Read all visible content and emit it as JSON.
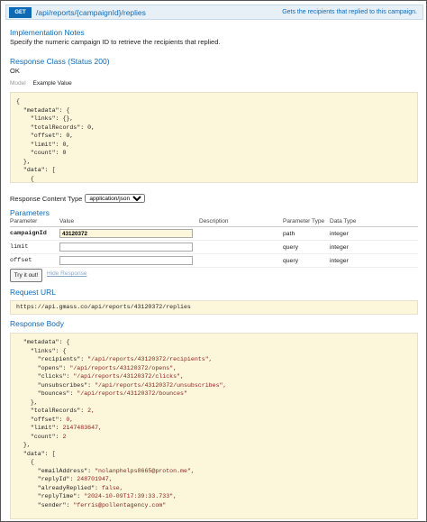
{
  "operation": {
    "method": "GET",
    "path": "/api/reports/{campaignId}/replies",
    "summary": "Gets the recipients that replied to this campaign."
  },
  "implementation_notes": {
    "heading": "Implementation Notes",
    "text": "Specify the numeric campaign ID to retrieve the recipients that replied."
  },
  "response_class": {
    "heading": "Response Class (Status 200)",
    "text": "OK"
  },
  "tabs": {
    "model": "Model",
    "example": "Example Value"
  },
  "example_lines": [
    "{",
    "  \"metadata\": {",
    "    \"links\": {},",
    "    \"totalRecords\": 0,",
    "    \"offset\": 0,",
    "    \"limit\": 0,",
    "    \"count\": 0",
    "  },",
    "  \"data\": [",
    "    {"
  ],
  "response_content_type": {
    "label": "Response Content Type",
    "value": "application/json"
  },
  "parameters": {
    "heading": "Parameters",
    "columns": [
      "Parameter",
      "Value",
      "Description",
      "Parameter Type",
      "Data Type"
    ],
    "rows": [
      {
        "name": "campaignId",
        "value": "43120372",
        "description": "",
        "ptype": "path",
        "dtype": "integer"
      },
      {
        "name": "limit",
        "value": "",
        "description": "",
        "ptype": "query",
        "dtype": "integer"
      },
      {
        "name": "offset",
        "value": "",
        "description": "",
        "ptype": "query",
        "dtype": "integer"
      }
    ]
  },
  "buttons": {
    "try": "Try it out!",
    "hide": "Hide Response"
  },
  "request_url": {
    "heading": "Request URL",
    "value": "https://api.gmass.co/api/reports/43120372/replies"
  },
  "response_body": {
    "heading": "Response Body",
    "lines": [
      [
        "  \"metadata\": {",
        ""
      ],
      [
        "    \"links\": {",
        ""
      ],
      [
        "      \"recipients\": ",
        "\"/api/reports/43120372/recipients\","
      ],
      [
        "      \"opens\": ",
        "\"/api/reports/43120372/opens\","
      ],
      [
        "      \"clicks\": ",
        "\"/api/reports/43120372/clicks\","
      ],
      [
        "      \"unsubscribes\": ",
        "\"/api/reports/43120372/unsubscribes\","
      ],
      [
        "      \"bounces\": ",
        "\"/api/reports/43120372/bounces\""
      ],
      [
        "    },",
        ""
      ],
      [
        "    \"totalRecords\": ",
        "2,"
      ],
      [
        "    \"offset\": ",
        "0,"
      ],
      [
        "    \"limit\": ",
        "2147483647,"
      ],
      [
        "    \"count\": ",
        "2"
      ],
      [
        "  },",
        ""
      ],
      [
        "  \"data\": [",
        ""
      ],
      [
        "    {",
        ""
      ],
      [
        "      \"emailAddress\": ",
        "\"nolanphelps8665@proton.me\","
      ],
      [
        "      \"replyId\": ",
        "248701947,"
      ],
      [
        "      \"alreadyReplied\": ",
        "false,"
      ],
      [
        "      \"replyTime\": ",
        "\"2024-10-09T17:39:33.733\","
      ],
      [
        "      \"sender\": ",
        "\"ferris@pollentagency.com\""
      ]
    ]
  }
}
